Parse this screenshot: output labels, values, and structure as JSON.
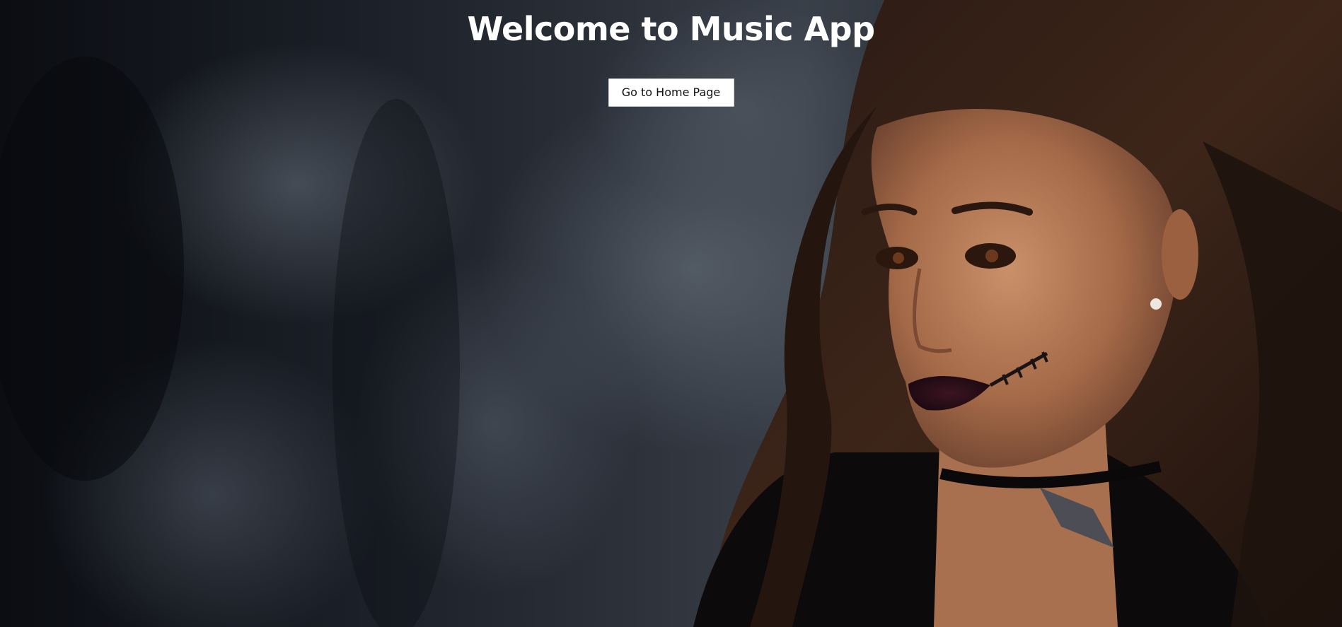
{
  "hero": {
    "title": "Welcome to Music App",
    "button_label": "Go to Home Page",
    "background": "portrait-photo-dark-smoky-backdrop"
  },
  "colors": {
    "title_text": "#ffffff",
    "button_bg": "#ffffff",
    "button_text": "#111111",
    "backdrop_dark": "#0d0f14"
  }
}
